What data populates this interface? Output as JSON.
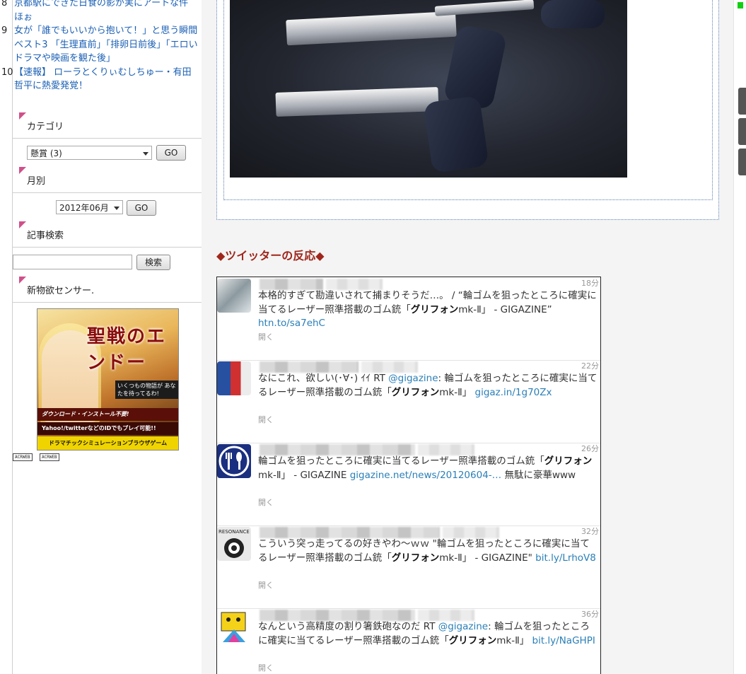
{
  "ranking": [
    {
      "num": "8",
      "title": "京都駅にできた日食の影が実にアートな件　ほぉ"
    },
    {
      "num": "9",
      "title": "女が「誰でもいいから抱いて！」と思う瞬間ベスト3 「生理直前」「排卵日前後」「エロいドラマや映画を観た後」"
    },
    {
      "num": "10",
      "title": "【速報】 ローラとくりぃむしちゅー・有田哲平に熱愛発覚！"
    }
  ],
  "sidebar": {
    "category_title": "カテゴリ",
    "category_selected": "懸賞 (3)",
    "go_label": "GO",
    "monthly_title": "月別",
    "month_selected": "2012年06月",
    "search_title": "記事検索",
    "search_button": "検索",
    "sensor_title": "新物欲センサー."
  },
  "banner": {
    "logo": "聖戦のエンドー",
    "tagline": "いくつもの物語が あなたを待ってるわ!",
    "line1": "ダウンロード・インストール不要!",
    "line2": "Yahoo!/twitterなどのIDでもプレイ可能!!",
    "line3": "ドラマチックシミュレーションブラウザゲーム"
  },
  "badges": [
    "ACRWEB",
    "ACRWEB"
  ],
  "main": {
    "section_title": "◆ツイッターの反応◆"
  },
  "tweets": [
    {
      "time": "18分",
      "parts": [
        "本格的すぎて勘違いされて捕まりそうだ…。 / “輪ゴムを狙ったところに確実に当てるレーザー照準搭載のゴム銃「",
        "グリフォン",
        "mk-Ⅱ」 - GIGAZINE” ",
        "htn.to/sa7ehC"
      ],
      "open": "開く"
    },
    {
      "time": "22分",
      "parts": [
        "なにこれ、欲しい(･∀･) ｲｲ RT ",
        "@gigazine",
        ": 輪ゴムを狙ったところに確実に当てるレーザー照準搭載のゴム銃「",
        "グリフォン",
        "mk-Ⅱ」 ",
        "gigaz.in/1g70Zx"
      ],
      "open": "開く"
    },
    {
      "time": "26分",
      "parts": [
        "輪ゴムを狙ったところに確実に当てるレーザー照準搭載のゴム銃「",
        "グリフォン",
        "mk-Ⅱ」 - GIGAZINE ",
        "gigazine.net/news/20120604-…",
        " 無駄に豪華www"
      ],
      "open": "開く"
    },
    {
      "time": "32分",
      "parts": [
        "こういう突っ走ってるの好きやわ～ｗｗ \"輪ゴムを狙ったところに確実に当てるレーザー照準搭載のゴム銃「",
        "グリフォン",
        "mk-Ⅱ」 - GIGAZINE\" ",
        "bit.ly/LrhoV8"
      ],
      "open": "開く"
    },
    {
      "time": "36分",
      "parts": [
        "なんという高精度の割り箸鉄砲なのだ RT ",
        "@gigazine",
        ": 輪ゴムを狙ったところに確実に当てるレーザー照準搭載のゴム銃「",
        "グリフォン",
        "mk-Ⅱ」 ",
        "bit.ly/NaGHPI"
      ],
      "open": "開く"
    }
  ],
  "colors": {
    "link": "#1a5fb4",
    "section_title": "#a0261c",
    "tweet_link": "#2a7fb8",
    "marker": "#d0508a"
  }
}
